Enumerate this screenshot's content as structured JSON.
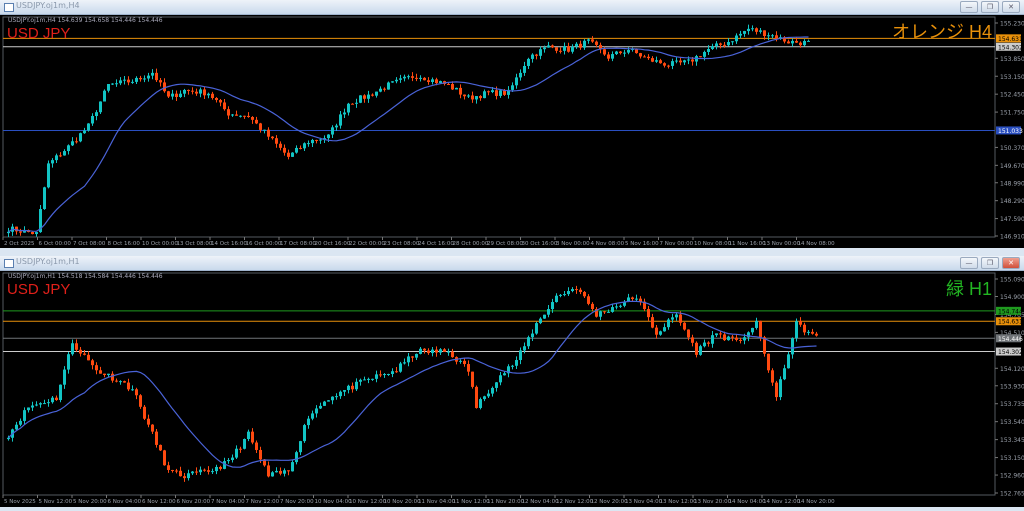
{
  "windows": [
    {
      "title": "USDJPY.oj1m,H4",
      "header_text": "USDJPY.oj1m,H4  154.639 154.658 154.446 154.446",
      "symbol_label": "USD JPY",
      "tag_label": "オレンジ H4",
      "tag_color": "#e8900a",
      "buttons": {
        "minimize": "—",
        "restore": "❐",
        "close": "✕"
      }
    },
    {
      "title": "USDJPY.oj1m,H1",
      "header_text": "USDJPY.oj1m,H1  154.518 154.584 154.446 154.446",
      "symbol_label": "USD JPY",
      "tag_label": "緑 H1",
      "tag_color": "#22b522",
      "buttons": {
        "minimize": "—",
        "restore": "❐",
        "close": "✕"
      }
    }
  ],
  "colors": {
    "bull": "#12c4c4",
    "bear": "#ff4a10",
    "ma": "#4a63d8",
    "grid_text": "#9aa0aa"
  },
  "chart_data": [
    {
      "type": "candlestick",
      "timeframe": "H4",
      "ylim": [
        146.91,
        155.23
      ],
      "price_ticks": [
        "155.230",
        "153.850",
        "153.150",
        "152.450",
        "151.750",
        "150.370",
        "149.670",
        "148.990",
        "148.290",
        "147.590",
        "146.910"
      ],
      "x_labels": [
        "2 Oct 2025",
        "6 Oct 00:00",
        "7 Oct 08:00",
        "8 Oct 16:00",
        "10 Oct 00:00",
        "13 Oct 08:00",
        "14 Oct 16:00",
        "16 Oct 00:00",
        "17 Oct 08:00",
        "20 Oct 16:00",
        "22 Oct 00:00",
        "23 Oct 08:00",
        "24 Oct 16:00",
        "28 Oct 00:00",
        "29 Oct 08:00",
        "30 Oct 16:00",
        "3 Nov 00:00",
        "4 Nov 08:00",
        "5 Nov 16:00",
        "7 Nov 00:00",
        "10 Nov 08:00",
        "11 Nov 16:00",
        "13 Nov 00:00",
        "14 Nov 08:00"
      ],
      "levels": [
        {
          "price": "154.631",
          "color": "#e8900a",
          "text": "#000"
        },
        {
          "price": "154.302",
          "color": "#cccccc",
          "text": "#000"
        },
        {
          "price": "151.033",
          "color": "#2a4fc0",
          "text": "#fff"
        }
      ],
      "close_path": [
        [
          0,
          147.2
        ],
        [
          7,
          147.0
        ],
        [
          10,
          149.7
        ],
        [
          15,
          150.4
        ],
        [
          20,
          151.2
        ],
        [
          25,
          152.8
        ],
        [
          32,
          153.0
        ],
        [
          36,
          153.3
        ],
        [
          40,
          152.3
        ],
        [
          44,
          152.6
        ],
        [
          50,
          152.5
        ],
        [
          55,
          151.7
        ],
        [
          60,
          151.6
        ],
        [
          65,
          150.8
        ],
        [
          70,
          150.0
        ],
        [
          75,
          150.6
        ],
        [
          80,
          150.8
        ],
        [
          85,
          152.1
        ],
        [
          90,
          152.4
        ],
        [
          95,
          152.8
        ],
        [
          102,
          153.2
        ],
        [
          110,
          152.8
        ],
        [
          115,
          152.3
        ],
        [
          120,
          152.5
        ],
        [
          125,
          152.5
        ],
        [
          130,
          153.9
        ],
        [
          135,
          154.3
        ],
        [
          140,
          154.2
        ],
        [
          145,
          154.5
        ],
        [
          150,
          153.9
        ],
        [
          155,
          154.2
        ],
        [
          160,
          153.8
        ],
        [
          165,
          153.6
        ],
        [
          170,
          153.7
        ],
        [
          175,
          154.2
        ],
        [
          180,
          154.5
        ],
        [
          185,
          155.0
        ],
        [
          190,
          154.8
        ],
        [
          195,
          154.5
        ],
        [
          200,
          154.45
        ]
      ]
    },
    {
      "type": "candlestick",
      "timeframe": "H1",
      "ylim": [
        152.765,
        155.09
      ],
      "price_ticks": [
        "155.090",
        "154.900",
        "154.705",
        "154.510",
        "154.120",
        "153.930",
        "153.735",
        "153.540",
        "153.345",
        "153.150",
        "152.960",
        "152.765"
      ],
      "x_labels": [
        "5 Nov 2025",
        "5 Nov 12:00",
        "5 Nov 20:00",
        "6 Nov 04:00",
        "6 Nov 12:00",
        "6 Nov 20:00",
        "7 Nov 04:00",
        "7 Nov 12:00",
        "7 Nov 20:00",
        "10 Nov 04:00",
        "10 Nov 12:00",
        "10 Nov 20:00",
        "11 Nov 04:00",
        "11 Nov 12:00",
        "11 Nov 20:00",
        "12 Nov 04:00",
        "12 Nov 12:00",
        "12 Nov 20:00",
        "13 Nov 04:00",
        "13 Nov 12:00",
        "13 Nov 20:00",
        "14 Nov 04:00",
        "14 Nov 12:00",
        "14 Nov 20:00"
      ],
      "levels": [
        {
          "price": "154.744",
          "color": "#1f9a1f",
          "text": "#000"
        },
        {
          "price": "154.631",
          "color": "#e8900a",
          "text": "#000"
        },
        {
          "price": "154.446",
          "color": "#707478",
          "text": "#fff"
        },
        {
          "price": "154.302",
          "color": "#cccccc",
          "text": "#000"
        }
      ],
      "close_path": [
        [
          0,
          153.4
        ],
        [
          5,
          153.7
        ],
        [
          12,
          153.8
        ],
        [
          16,
          154.4
        ],
        [
          22,
          154.1
        ],
        [
          27,
          154.0
        ],
        [
          31,
          153.9
        ],
        [
          35,
          153.5
        ],
        [
          40,
          153.0
        ],
        [
          44,
          152.95
        ],
        [
          50,
          153.0
        ],
        [
          55,
          153.1
        ],
        [
          60,
          153.4
        ],
        [
          65,
          152.95
        ],
        [
          70,
          153.0
        ],
        [
          75,
          153.6
        ],
        [
          80,
          153.8
        ],
        [
          85,
          153.9
        ],
        [
          90,
          154.0
        ],
        [
          97,
          154.1
        ],
        [
          102,
          154.3
        ],
        [
          110,
          154.3
        ],
        [
          115,
          154.1
        ],
        [
          117,
          153.7
        ],
        [
          122,
          154.0
        ],
        [
          127,
          154.2
        ],
        [
          132,
          154.6
        ],
        [
          137,
          154.9
        ],
        [
          142,
          155.0
        ],
        [
          147,
          154.7
        ],
        [
          152,
          154.8
        ],
        [
          157,
          154.9
        ],
        [
          162,
          154.5
        ],
        [
          167,
          154.7
        ],
        [
          172,
          154.3
        ],
        [
          177,
          154.5
        ],
        [
          182,
          154.4
        ],
        [
          187,
          154.6
        ],
        [
          192,
          153.8
        ],
        [
          195,
          154.3
        ],
        [
          197,
          154.6
        ],
        [
          202,
          154.45
        ]
      ]
    }
  ]
}
